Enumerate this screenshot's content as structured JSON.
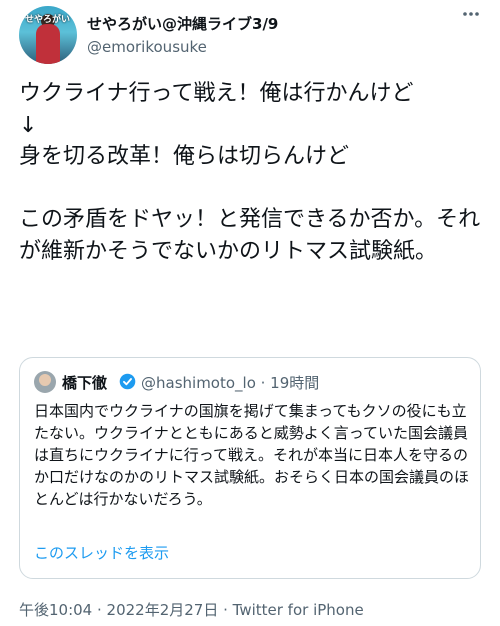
{
  "tweet": {
    "display_name": "せやろがい@沖縄ライブ3/9",
    "handle": "@emorikousuke",
    "avatar_text": "せやろがい",
    "more_icon": "more-icon",
    "text": "ウクライナ行って戦え！俺は行かんけど\n↓\n身を切る改革！俺らは切らんけど\n\nこの矛盾をドヤッ！と発信できるか否か。それが維新かそうでないかのリトマス試験紙。",
    "meta": "午後10:04 · 2022年2月27日 · Twitter for iPhone"
  },
  "quote": {
    "display_name": "橋下徹",
    "handle_time": "@hashimoto_lo · 19時間",
    "verified_icon": "verified-badge-icon",
    "text": "日本国内でウクライナの国旗を掲げて集まってもクソの役にも立たない。ウクライナとともにあると威勢よく言っていた国会議員は直ちにウクライナに行って戦え。それが本当に日本人を守るのか口だけなのかのリトマス試験紙。おそらく日本の国会議員のほとんどは行かないだろう。",
    "thread_link": "このスレッドを表示"
  },
  "colors": {
    "text": "#0f1419",
    "secondary": "#536471",
    "link": "#1d9bf0",
    "border": "#cfd9de"
  }
}
